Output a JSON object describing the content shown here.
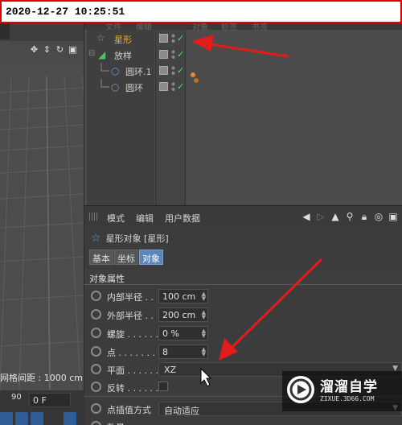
{
  "timestamp": "2020-12-27 10:25:51",
  "viewport": {
    "grid_spacing_label": "网格间距 : 1000 cm",
    "nav_icons": [
      "move-icon",
      "vertical-move-icon",
      "rotate-icon",
      "frame-icon"
    ]
  },
  "timeline": {
    "end_frame": "90",
    "current_frame": "0 F"
  },
  "object_manager": {
    "header_labels": [
      "文件",
      "编辑",
      "对象",
      "标签",
      "书签"
    ],
    "objects": [
      {
        "name": "星形",
        "icon": "star-icon",
        "color": "#f0b030",
        "indent": 0
      },
      {
        "name": "放样",
        "icon": "loft-icon",
        "color": "#cfcfcf",
        "indent": 0
      },
      {
        "name": "圆环.1",
        "icon": "circle-icon",
        "color": "#cfcfcf",
        "indent": 1
      },
      {
        "name": "圆环",
        "icon": "circle-icon",
        "color": "#cfcfcf",
        "indent": 1
      }
    ]
  },
  "attribute_manager": {
    "menu": [
      "模式",
      "编辑",
      "用户数据"
    ],
    "object_title": "星形对象 [星形]",
    "tabs": [
      {
        "label": "基本",
        "active": false
      },
      {
        "label": "坐标",
        "active": false
      },
      {
        "label": "对象",
        "active": true
      }
    ],
    "section_title": "对象属性",
    "properties": {
      "inner_radius": {
        "label": "内部半径 . .",
        "value": "100 cm"
      },
      "outer_radius": {
        "label": "外部半径 . .",
        "value": "200 cm"
      },
      "twist": {
        "label": "螺旋 . . . . . .",
        "value": "0 %"
      },
      "points": {
        "label": "点 . . . . . . . .",
        "value": "8"
      },
      "plane": {
        "label": "平面 . . . . . .",
        "value": "XZ"
      },
      "reverse": {
        "label": "反转 . . . . . .",
        "checked": false
      },
      "interpolation": {
        "label": "点插值方式",
        "value": "自动适应"
      },
      "count": {
        "label": "数量"
      }
    }
  },
  "watermark": {
    "brand": "溜溜自学",
    "url": "ZIXUE.3D66.COM"
  },
  "colors": {
    "accent_tab": "#5c85b8",
    "check": "#55dd55",
    "arrow": "#e21b1b",
    "star": "#5a9fe0"
  }
}
